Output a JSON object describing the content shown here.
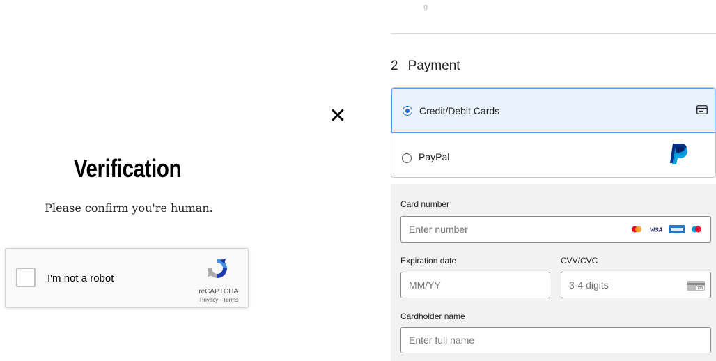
{
  "verification": {
    "title": "Verification",
    "subtitle": "Please confirm you're human.",
    "recaptcha": {
      "checkbox_label": "I'm not a robot",
      "brand": "reCAPTCHA",
      "links": "Privacy - Terms"
    },
    "close_glyph": "✕"
  },
  "payment": {
    "step_number": "2",
    "step_title": "Payment",
    "methods": [
      {
        "label": "Credit/Debit Cards",
        "selected": true,
        "icon": "credit-card-icon"
      },
      {
        "label": "PayPal",
        "selected": false,
        "icon": "paypal-logo-icon"
      }
    ],
    "form": {
      "card_number": {
        "label": "Card number",
        "placeholder": "Enter number"
      },
      "expiration": {
        "label": "Expiration date",
        "placeholder": "MM/YY"
      },
      "cvv": {
        "label": "CVV/CVC",
        "placeholder": "3-4 digits"
      },
      "cardholder": {
        "label": "Cardholder name",
        "placeholder": "Enter full name"
      },
      "card_brands": [
        "mastercard-icon",
        "visa-icon",
        "amex-icon",
        "maestro-icon"
      ]
    }
  },
  "colors": {
    "selected_bg": "#e9f2fd",
    "selected_border": "#5a9ae0",
    "radio_accent": "#2a6fd0",
    "form_bg": "#f2f2f2"
  }
}
